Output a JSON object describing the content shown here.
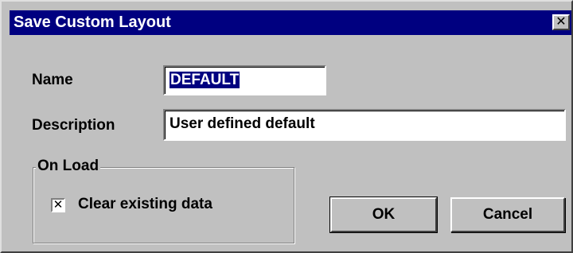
{
  "dialog": {
    "title": "Save Custom Layout",
    "close_icon_glyph": "✕"
  },
  "fields": {
    "name_label": "Name",
    "name_value": "DEFAULT",
    "description_label": "Description",
    "description_value": "User defined default"
  },
  "on_load": {
    "group_label": "On Load",
    "clear_existing_data_label": "Clear existing data",
    "clear_existing_data_checked": true,
    "check_glyph": "✕"
  },
  "buttons": {
    "ok_label": "OK",
    "cancel_label": "Cancel"
  },
  "colors": {
    "titlebar": "#000080",
    "dialog_face": "#c0c0c0",
    "selection": "#000080"
  }
}
